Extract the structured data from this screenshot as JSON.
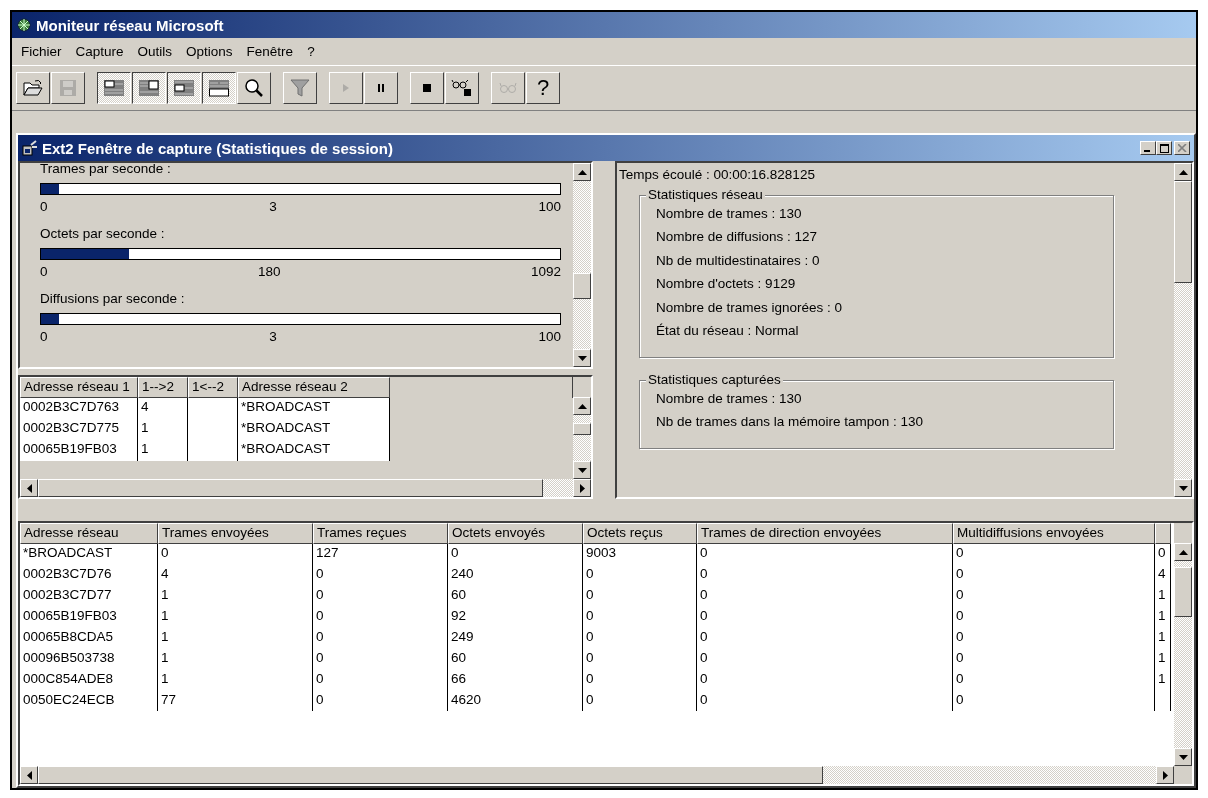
{
  "window": {
    "title": "Moniteur réseau Microsoft"
  },
  "menu": [
    "Fichier",
    "Capture",
    "Outils",
    "Options",
    "Fenêtre",
    "?"
  ],
  "toolbar": [
    {
      "kind": "open",
      "pressed": false,
      "disabled": false
    },
    {
      "kind": "save",
      "pressed": false,
      "disabled": true
    },
    {
      "kind": "pane1",
      "pressed": true,
      "disabled": false
    },
    {
      "kind": "pane2",
      "pressed": true,
      "disabled": false
    },
    {
      "kind": "pane3",
      "pressed": true,
      "disabled": false
    },
    {
      "kind": "pane4",
      "pressed": true,
      "disabled": false
    },
    {
      "kind": "search",
      "pressed": false,
      "disabled": false
    },
    {
      "kind": "filter",
      "pressed": false,
      "disabled": false
    },
    {
      "kind": "play",
      "pressed": false,
      "disabled": true
    },
    {
      "kind": "pause",
      "pressed": false,
      "disabled": false
    },
    {
      "kind": "stop",
      "pressed": false,
      "disabled": false
    },
    {
      "kind": "stopview",
      "pressed": false,
      "disabled": false
    },
    {
      "kind": "view",
      "pressed": false,
      "disabled": true
    },
    {
      "kind": "help",
      "label": "?",
      "pressed": false,
      "disabled": false
    }
  ],
  "capture_window": {
    "title": "Ext2 Fenêtre de capture (Statistiques de session)",
    "gauges": [
      {
        "label": "Trames par seconde :",
        "level": 0.035,
        "min": "0",
        "mid": "3",
        "max": "100"
      },
      {
        "label": "Octets par seconde :",
        "level": 0.17,
        "min": "0",
        "mid": "180",
        "max": "1092"
      },
      {
        "label": "Diffusions par seconde :",
        "level": 0.035,
        "min": "0",
        "mid": "3",
        "max": "100"
      }
    ],
    "pair_table": {
      "columns": [
        "Adresse réseau 1",
        "1-->2",
        "1<--2",
        "Adresse réseau 2"
      ],
      "rows": [
        {
          "address_1": "0002B3C7D763",
          "frames_1_to_2": "4",
          "address_2": "*BROADCAST"
        },
        {
          "address_1": "0002B3C7D775",
          "frames_1_to_2": "1",
          "address_2": "*BROADCAST"
        },
        {
          "address_1": "00065B19FB03",
          "frames_1_to_2": "1",
          "address_2": "*BROADCAST"
        }
      ]
    },
    "session_stats": {
      "elapsed": "Temps écoulé : 00:00:16.828125",
      "groups": [
        {
          "title": "Statistiques réseau",
          "lines": [
            "Nombre de trames : 130",
            "Nombre de diffusions : 127",
            "Nb de multidestinataires : 0",
            "Nombre d'octets : 9129",
            "Nombre de trames ignorées : 0",
            "État du réseau : Normal"
          ]
        },
        {
          "title": "Statistiques capturées",
          "lines": [
            "Nombre de trames : 130",
            "Nb de trames dans la mémoire tampon : 130"
          ]
        }
      ]
    },
    "station_table": {
      "columns": [
        "Adresse réseau",
        "Trames envoyées",
        "Trames reçues",
        "Octets envoyés",
        "Octets reçus",
        "Trames de direction envoyées",
        "Multidiffusions envoyées"
      ],
      "rows": [
        [
          "*BROADCAST",
          "0",
          "127",
          "0",
          "9003",
          "0",
          "0",
          "0"
        ],
        [
          "0002B3C7D76",
          "4",
          "0",
          "240",
          "0",
          "0",
          "0",
          "4"
        ],
        [
          "0002B3C7D77",
          "1",
          "0",
          "60",
          "0",
          "0",
          "0",
          "1"
        ],
        [
          "00065B19FB03",
          "1",
          "0",
          "92",
          "0",
          "0",
          "0",
          "1"
        ],
        [
          "00065B8CDA5",
          "1",
          "0",
          "249",
          "0",
          "0",
          "0",
          "1"
        ],
        [
          "00096B503738",
          "1",
          "0",
          "60",
          "0",
          "0",
          "0",
          "1"
        ],
        [
          "000C854ADE8",
          "1",
          "0",
          "66",
          "0",
          "0",
          "0",
          "1"
        ],
        [
          "0050EC24ECB",
          "77",
          "0",
          "4620",
          "0",
          "0",
          "0"
        ]
      ]
    }
  }
}
